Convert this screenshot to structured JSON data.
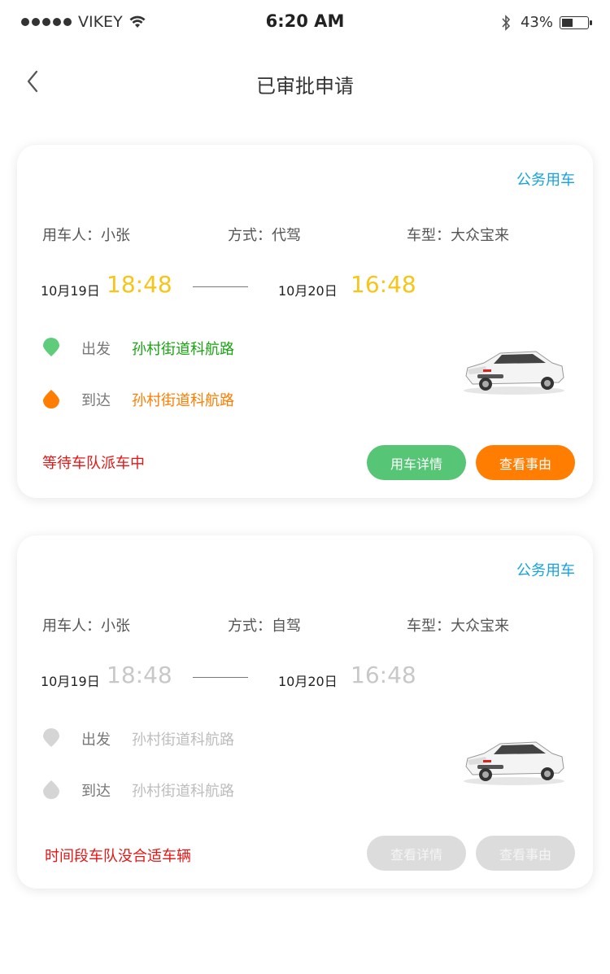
{
  "status_bar": {
    "carrier": "VIKEY",
    "time": "6:20 AM",
    "battery": "43%"
  },
  "nav": {
    "title": "已审批申请",
    "back_icon": "chevron-left-icon"
  },
  "colors": {
    "accent_blue": "#17a2e3",
    "time_yellow": "#f5c518",
    "green": "#57c576",
    "orange": "#ff7d00",
    "status_red": "#e51616",
    "disabled_gray": "#dcdcdc"
  },
  "cards": [
    {
      "tag": "公务用车",
      "user": "用车人：小张",
      "mode": "方式：代驾",
      "car_model": "车型：大众宝来",
      "start_date": "10月19日",
      "start_time": "18:48",
      "end_date": "10月20日",
      "end_time": "16:48",
      "from_label": "出发",
      "from_address": "孙村街道科航路",
      "to_label": "到达",
      "to_address": "孙村街道科航路",
      "status": "等待车队派车中",
      "button1": "用车详情",
      "button2": "查看事由"
    },
    {
      "tag": "公务用车",
      "user": "用车人：小张",
      "mode": "方式：自驾",
      "car_model": "车型：大众宝来",
      "start_date": "10月19日",
      "start_time": "18:48",
      "end_date": "10月20日",
      "end_time": "16:48",
      "from_label": "出发",
      "from_address": "孙村街道科航路",
      "to_label": "到达",
      "to_address": "孙村街道科航路",
      "status": "时间段车队没合适车辆",
      "button1": "查看详情",
      "button2": "查看事由"
    }
  ]
}
